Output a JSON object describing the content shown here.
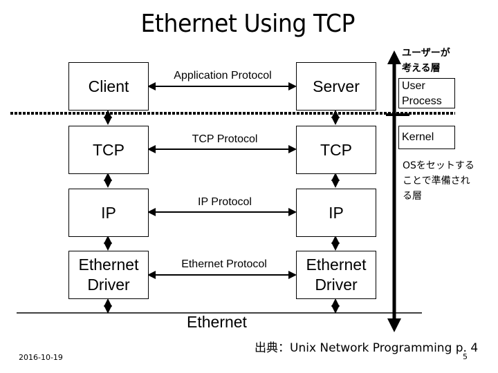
{
  "title": "Ethernet Using TCP",
  "client_stack": [
    {
      "label": "Client"
    },
    {
      "label": "TCP"
    },
    {
      "label": "IP"
    },
    {
      "label": "Ethernet\nDriver"
    }
  ],
  "server_stack": [
    {
      "label": "Server"
    },
    {
      "label": "TCP"
    },
    {
      "label": "IP"
    },
    {
      "label": "Ethernet\nDriver"
    }
  ],
  "protocols": [
    {
      "label": "Application Protocol"
    },
    {
      "label": "TCP Protocol"
    },
    {
      "label": "IP Protocol"
    },
    {
      "label": "Ethernet Protocol"
    }
  ],
  "network_label": "Ethernet",
  "side": {
    "user_note": "ユーザーが\n考える層",
    "user_box": "User\nProcess",
    "kernel_box": "Kernel",
    "kernel_note": "OSをセットする\nことで準備され\nる層"
  },
  "footer": {
    "source": "出典：Unix Network Programming p. 4",
    "date": "2016-10-19",
    "page_number": "5"
  }
}
